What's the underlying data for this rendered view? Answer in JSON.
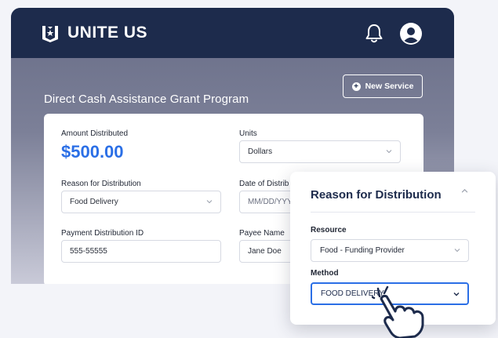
{
  "app": {
    "brand": "UNITE US"
  },
  "header": {
    "page_title": "Direct Cash Assistance Grant Program",
    "new_service_label": "New Service"
  },
  "icons": {
    "brand": "unite-us-logo-icon",
    "notifications": "bell-icon",
    "account": "user-circle-icon",
    "add": "plus-circle-icon",
    "dropdown": "chevron-down-icon",
    "collapse": "chevron-up-icon",
    "cursor": "hand-pointer-icon"
  },
  "colors": {
    "navy": "#1d2b4c",
    "accent_blue": "#2b6fe6"
  },
  "form": {
    "amount_label": "Amount Distributed",
    "amount_value": "$500.00",
    "units_label": "Units",
    "units_value": "Dollars",
    "reason_label": "Reason for Distribution",
    "reason_value": "Food Delivery",
    "date_label": "Date of Distrib",
    "date_placeholder": "MM/DD/YYY",
    "payment_id_label": "Payment Distribution ID",
    "payment_id_value": "555-55555",
    "payee_label": "Payee Name",
    "payee_value": "Jane Doe"
  },
  "popover": {
    "title": "Reason for Distribution",
    "resource_label": "Resource",
    "resource_value": "Food - Funding Provider",
    "method_label": "Method",
    "method_value": "FOOD DELIVERY"
  }
}
